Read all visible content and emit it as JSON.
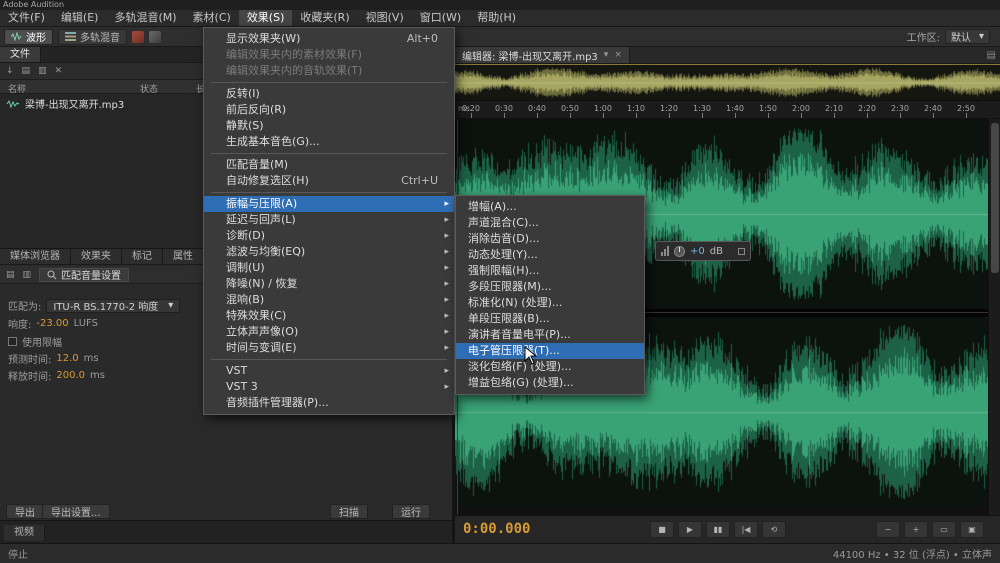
{
  "app": {
    "title": "Adobe Audition"
  },
  "menubar": {
    "items": [
      "文件(F)",
      "编辑(E)",
      "多轨混音(M)",
      "素材(C)",
      "效果(S)",
      "收藏夹(R)",
      "视图(V)",
      "窗口(W)",
      "帮助(H)"
    ],
    "active_index": 4
  },
  "toolbar": {
    "waveform_button": "波形",
    "multitrack_button": "多轨混音",
    "workspace_label": "工作区:",
    "workspace_value": "默认"
  },
  "files_panel": {
    "tab": "文件",
    "columns": [
      "名称",
      "状态",
      "长度"
    ],
    "file_name": "梁博-出现又离开.mp3"
  },
  "match_panel": {
    "tabs": [
      "媒体浏览器",
      "效果夹",
      "标记",
      "属性"
    ],
    "settings_button": "匹配音量设置",
    "match_label": "匹配为:",
    "match_value": "ITU-R BS.1770-2 响度",
    "loudness_label": "响度:",
    "loudness_value": "-23.00",
    "loudness_unit": "LUFS",
    "limiter_label": "使用限幅",
    "lookahead_label": "预测时间:",
    "lookahead_value": "12.0",
    "lookahead_unit": "ms",
    "release_label": "释放时间:",
    "release_value": "200.0",
    "release_unit": "ms",
    "export_button": "导出",
    "export_settings_button": "导出设置...",
    "scan_button": "扫描",
    "run_button": "运行",
    "bottom_tab": "视频"
  },
  "effects_menu": {
    "items": [
      {
        "label": "显示效果夹(W)",
        "shortcut": "Alt+0"
      },
      {
        "label": "编辑效果夹内的素材效果(F)",
        "disabled": true
      },
      {
        "label": "编辑效果夹内的音轨效果(T)",
        "disabled": true
      },
      {
        "separator": true
      },
      {
        "label": "反转(I)"
      },
      {
        "label": "前后反向(R)"
      },
      {
        "label": "静默(S)"
      },
      {
        "label": "生成基本音色(G)..."
      },
      {
        "separator": true
      },
      {
        "label": "匹配音量(M)"
      },
      {
        "label": "自动修复选区(H)",
        "shortcut": "Ctrl+U"
      },
      {
        "separator": true
      },
      {
        "label": "振幅与压限(A)",
        "submenu": true,
        "highlighted": true
      },
      {
        "label": "延迟与回声(L)",
        "submenu": true
      },
      {
        "label": "诊断(D)",
        "submenu": true
      },
      {
        "label": "滤波与均衡(EQ)",
        "submenu": true
      },
      {
        "label": "调制(U)",
        "submenu": true
      },
      {
        "label": "降噪(N) / 恢复",
        "submenu": true
      },
      {
        "label": "混响(B)",
        "submenu": true
      },
      {
        "label": "特殊效果(C)",
        "submenu": true
      },
      {
        "label": "立体声声像(O)",
        "submenu": true
      },
      {
        "label": "时间与变调(E)",
        "submenu": true
      },
      {
        "separator": true
      },
      {
        "label": "VST",
        "submenu": true
      },
      {
        "label": "VST 3",
        "submenu": true
      },
      {
        "label": "音频插件管理器(P)..."
      }
    ]
  },
  "amplitude_submenu": {
    "items": [
      {
        "label": "增幅(A)..."
      },
      {
        "label": "声道混合(C)..."
      },
      {
        "label": "消除齿音(D)..."
      },
      {
        "label": "动态处理(Y)..."
      },
      {
        "label": "强制限幅(H)..."
      },
      {
        "label": "多段压限器(M)..."
      },
      {
        "label": "标准化(N) (处理)..."
      },
      {
        "label": "单段压限器(B)..."
      },
      {
        "label": "演讲者音量电平(P)..."
      },
      {
        "label": "电子管压限器(T)...",
        "highlighted": true
      },
      {
        "label": "淡化包络(F) (处理)..."
      },
      {
        "label": "增益包络(G) (处理)..."
      }
    ]
  },
  "editor": {
    "tab_label": "编辑器: 梁博-出现又离开.mp3",
    "ruler_unit": "ms",
    "ruler_ticks": [
      "0:20",
      "0:30",
      "0:40",
      "0:50",
      "1:00",
      "1:10",
      "1:20",
      "1:30",
      "1:40",
      "1:50",
      "2:00",
      "2:10",
      "2:20",
      "2:30",
      "2:40",
      "2:50"
    ],
    "hud_value": "+0",
    "hud_unit": "dB",
    "time_display": "0:00.000"
  },
  "transport": {
    "left_buttons": [
      "stop",
      "play",
      "pause",
      "skip-to-start",
      "loop"
    ],
    "right_buttons": [
      "zoom-out",
      "zoom-in",
      "zoom-selection",
      "zoom-full"
    ]
  },
  "statusbar": {
    "left": "停止",
    "right": "44100 Hz • 32 位 (浮点) • 立体声"
  },
  "colors": {
    "accent_blue": "#2e6db4",
    "value_orange": "#d79b36",
    "wave_green": "#3aa376"
  }
}
